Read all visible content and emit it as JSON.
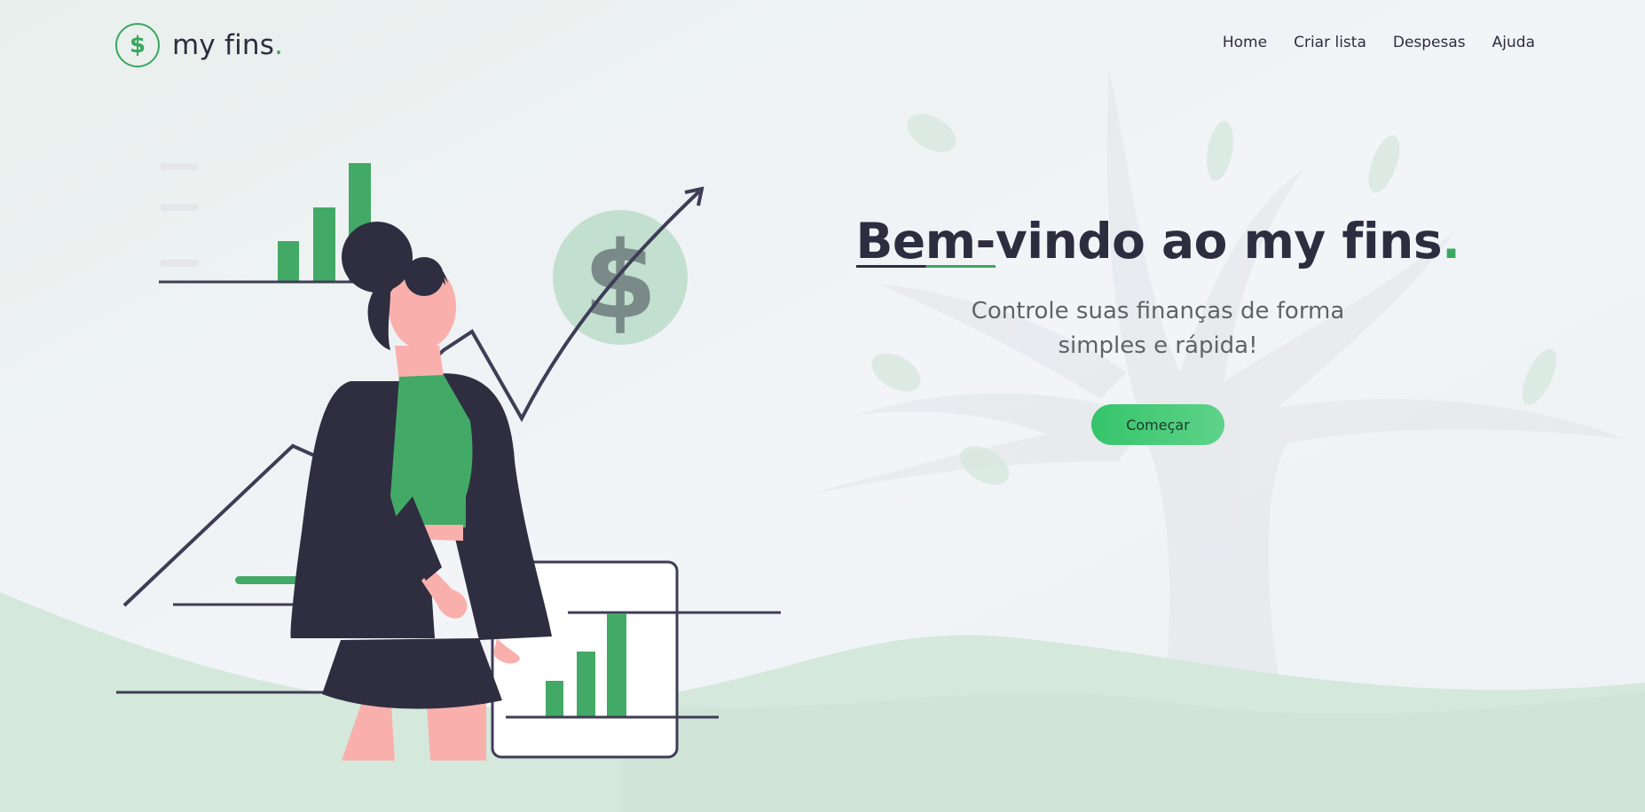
{
  "header": {
    "logo_symbol": "$",
    "brand": "my fins",
    "brand_dot": "."
  },
  "nav": {
    "items": [
      {
        "label": "Home"
      },
      {
        "label": "Criar lista"
      },
      {
        "label": "Despesas"
      },
      {
        "label": "Ajuda"
      }
    ]
  },
  "hero": {
    "title_underlined": "Bem-",
    "title_rest": "vindo ao my fins",
    "title_dot": ".",
    "subtitle": "Controle suas finanças de forma simples e rápida!",
    "cta_label": "Começar"
  },
  "illustration": {
    "coin_symbol": "$"
  },
  "colors": {
    "accent": "#3aa75f",
    "dark": "#2e2d40",
    "skin": "#f9b0ad",
    "background": "#eef2f4"
  }
}
